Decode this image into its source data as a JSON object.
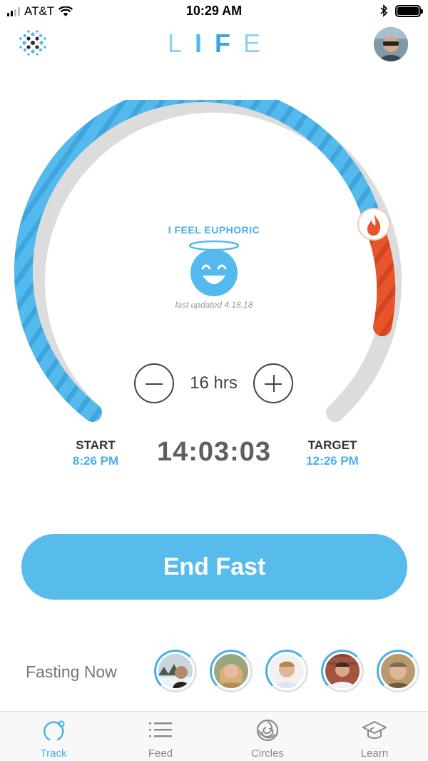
{
  "status_bar": {
    "carrier": "AT&T",
    "time": "10:29 AM",
    "icons": [
      "signal-icon",
      "wifi-icon",
      "bluetooth-icon",
      "battery-icon"
    ]
  },
  "header": {
    "wordmark": [
      "L",
      "I",
      "F",
      "E"
    ],
    "logo_icon": "dot-cluster-logo",
    "profile_icon": "user-avatar"
  },
  "dial": {
    "progress_fraction": 0.88,
    "target_hours": 16,
    "colors": {
      "progress": "#54b9ec",
      "overtime": "#e8552a",
      "track": "#dcdcdc",
      "flame_badge": "#e8552a"
    },
    "flame_icon": "flame-icon"
  },
  "mood": {
    "label": "I FEEL EUPHORIC",
    "icon": "euphoric-halo-face-icon",
    "updated": "last updated 4.18.18"
  },
  "stepper": {
    "minus_icon": "minus-icon",
    "plus_icon": "plus-icon",
    "value": "16 hrs"
  },
  "times": {
    "start_label": "START",
    "start_value": "8:26 PM",
    "elapsed": "14:03:03",
    "target_label": "TARGET",
    "target_value": "12:26 PM"
  },
  "action": {
    "end_fast_label": "End Fast",
    "color": "#57bbec"
  },
  "fasting_now": {
    "label": "Fasting Now",
    "avatars": [
      {
        "icon": "user-avatar"
      },
      {
        "icon": "user-avatar"
      },
      {
        "icon": "user-avatar"
      },
      {
        "icon": "user-avatar"
      },
      {
        "icon": "user-avatar"
      }
    ]
  },
  "tabs": [
    {
      "label": "Track",
      "icon": "track-icon",
      "active": true
    },
    {
      "label": "Feed",
      "icon": "feed-list-icon",
      "active": false
    },
    {
      "label": "Circles",
      "icon": "circles-swirl-icon",
      "active": false
    },
    {
      "label": "Learn",
      "icon": "graduation-cap-icon",
      "active": false
    }
  ],
  "accent_color": "#4ab0e8"
}
